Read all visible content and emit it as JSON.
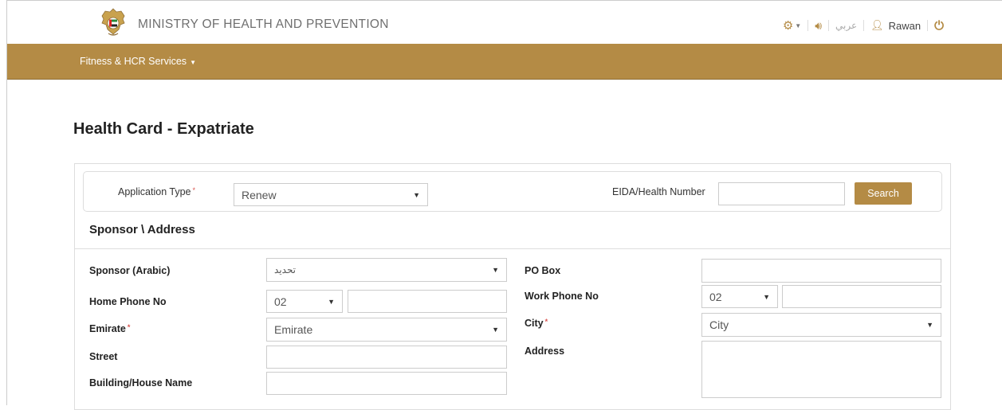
{
  "header": {
    "ministry_name": "MINISTRY OF HEALTH AND PREVENTION",
    "arabic_label": "عربي",
    "user_name": "Rawan",
    "brand_color": "#b48b45"
  },
  "nav": {
    "menu_label": "Fitness & HCR Services"
  },
  "page": {
    "title": "Health Card - Expatriate"
  },
  "search": {
    "application_type_label": "Application Type",
    "application_type_value": "Renew",
    "eida_label": "EIDA/Health Number",
    "eida_value": "",
    "search_button": "Search"
  },
  "section": {
    "title": "Sponsor \\ Address"
  },
  "form": {
    "sponsor_arabic_label": "Sponsor (Arabic)",
    "sponsor_arabic_value": "تحديد",
    "home_phone_label": "Home Phone No",
    "home_phone_code": "02",
    "home_phone_value": "",
    "emirate_label": "Emirate",
    "emirate_value": "Emirate",
    "street_label": "Street",
    "street_value": "",
    "building_label": "Building/House Name",
    "building_value": "",
    "po_box_label": "PO Box",
    "po_box_value": "",
    "work_phone_label": "Work Phone No",
    "work_phone_code": "02",
    "work_phone_value": "",
    "city_label": "City",
    "city_value": "City",
    "address_label": "Address",
    "address_value": ""
  }
}
